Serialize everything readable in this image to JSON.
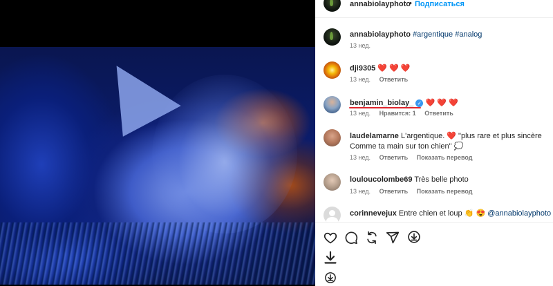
{
  "post": {
    "author": "annabiolayphoto",
    "separator": "•",
    "follow_label": "Подписаться"
  },
  "caption": {
    "author": "annabiolayphoto",
    "text": "#argentique #analog",
    "time": "13 нед."
  },
  "comments": [
    {
      "user": "dji9305",
      "text": "❤️ ❤️ ❤️",
      "time": "13 нед.",
      "reply_label": "Ответить"
    },
    {
      "user": "benjamin_biolay_",
      "verified": true,
      "text": "❤️ ❤️ ❤️",
      "time": "13 нед.",
      "likes_label": "Нравится: 1",
      "reply_label": "Ответить"
    },
    {
      "user": "laudelamarne",
      "text_line1": "L'argentique. ❤️ \"plus rare et plus sincère",
      "text_line2": "Comme ta main sur ton chien\" 💭",
      "time": "13 нед.",
      "reply_label": "Ответить",
      "translation_label": "Показать перевод"
    },
    {
      "user": "louloucolombe69",
      "text": "Très belle photo",
      "time": "13 нед.",
      "reply_label": "Ответить",
      "translation_label": "Показать перевод"
    },
    {
      "user": "corinnevejux",
      "text": "Entre chien et loup 👏 😍",
      "mention": "@annabiolayphoto"
    }
  ],
  "actions": {
    "like_icon": "heart-icon",
    "comment_icon": "comment-icon",
    "repost_icon": "repost-icon",
    "share_icon": "send-icon",
    "save_icon": "download-circle-icon",
    "download_icon": "download-icon",
    "download_circle_icon": "download-circle-icon"
  },
  "colors": {
    "accent": "#0095f6",
    "heart": "#ed1f45",
    "muted": "#737373",
    "verified": "#3897f0",
    "annotation": "#e0262d"
  }
}
